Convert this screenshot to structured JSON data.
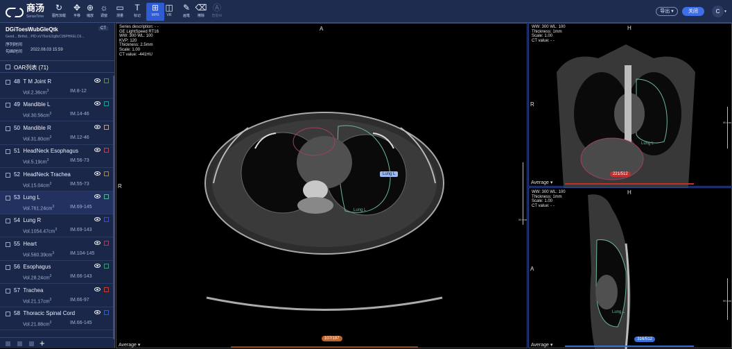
{
  "app": {
    "brand": "商汤",
    "brand_sub": "SenseTime"
  },
  "toolbar": {
    "tools": [
      {
        "id": "reset",
        "label": "图形加载",
        "icon": "reset-icon",
        "glyph": "↻"
      },
      {
        "id": "pan",
        "label": "平移",
        "icon": "pan-icon",
        "glyph": "✥"
      },
      {
        "id": "zoom",
        "label": "缩放",
        "icon": "zoom-icon",
        "glyph": "⊕"
      },
      {
        "id": "adjust",
        "label": "调窗",
        "icon": "brightness-icon",
        "glyph": "☼"
      },
      {
        "id": "measure",
        "label": "测量",
        "icon": "rectangle-icon",
        "glyph": "▭"
      },
      {
        "id": "annotate",
        "label": "标记",
        "icon": "text-icon",
        "glyph": "T"
      },
      {
        "id": "mpr",
        "label": "MPR",
        "icon": "mpr-layout-icon",
        "glyph": "⊞"
      },
      {
        "id": "vr",
        "label": "VR",
        "icon": "vr-layout-icon",
        "glyph": "◫"
      },
      {
        "id": "brush",
        "label": "画笔",
        "icon": "brush-icon",
        "glyph": "✎"
      },
      {
        "id": "erase",
        "label": "擦除",
        "icon": "eraser-icon",
        "glyph": "⌫"
      },
      {
        "id": "ai",
        "label": "智能AI",
        "icon": "ai-icon",
        "glyph": "Ⓐ"
      }
    ],
    "export_label": "导出",
    "close_label": "关闭",
    "avatar_letter": "C"
  },
  "patient": {
    "name": "DGiToesWubGleQtk",
    "modality": "CT",
    "meta": "Gend...   Birthd...   PID xV76xnU2g8cC95PHKELC6...",
    "seq_label": "序列时间",
    "draw_label": "勾画时间",
    "draw_time": "2022.08.03 15:59"
  },
  "oar": {
    "title": "OAR列表 (71)",
    "items": [
      {
        "idx": "48",
        "name": "T M Joint R",
        "vol": "Vol.2.36cm",
        "im": "IM.8-12",
        "color": "#5a8a5a"
      },
      {
        "idx": "49",
        "name": "Mandible L",
        "vol": "Vol.30.56cm",
        "im": "IM.14-46",
        "color": "#2a9aa0"
      },
      {
        "idx": "50",
        "name": "Mandible R",
        "vol": "Vol.31.80cm",
        "im": "IM.12-46",
        "color": "#b0a0a0"
      },
      {
        "idx": "51",
        "name": "HeadNeck Esophagus",
        "vol": "Vol.5.19cm",
        "im": "IM.56-73",
        "color": "#c04050"
      },
      {
        "idx": "52",
        "name": "HeadNeck Trachea",
        "vol": "Vol.15.04cm",
        "im": "IM.55-73",
        "color": "#a08850"
      },
      {
        "idx": "53",
        "name": "Lung L",
        "vol": "Vol.761.24cm",
        "im": "IM.69-145",
        "color": "#5ab0a0"
      },
      {
        "idx": "54",
        "name": "Lung R",
        "vol": "Vol.1054.47cm",
        "im": "IM.69-143",
        "color": "#4050c0"
      },
      {
        "idx": "55",
        "name": "Heart",
        "vol": "Vol.560.39cm",
        "im": "IM.104-145",
        "color": "#a04060"
      },
      {
        "idx": "56",
        "name": "Esophagus",
        "vol": "Vol.28.24cm",
        "im": "IM.66-143",
        "color": "#3a9a7a"
      },
      {
        "idx": "57",
        "name": "Trachea",
        "vol": "Vol.21.17cm",
        "im": "IM.66-97",
        "color": "#c04030"
      },
      {
        "idx": "58",
        "name": "Thoracic Spinal Cord",
        "vol": "Vol.21.88cm",
        "im": "IM.66-145",
        "color": "#3060c0"
      }
    ],
    "unit_sup": "3"
  },
  "axial": {
    "info": [
      "Series description: - -",
      "GE LightSpeed RT16",
      "WW: 300  WL: 100",
      "KVP: 120",
      "Thickness: 2.5mm",
      "Scale: 1.00",
      "CT value: -441HU"
    ],
    "orient_top": "A",
    "orient_left": "R",
    "contour_label": "Lung L",
    "contour_label2": "Lung L",
    "average_label": "Average",
    "slice": "107/197",
    "slice_frac": 0.54,
    "scale_label": "90 mm"
  },
  "coronal": {
    "info": [
      "WW: 300  WL: 100",
      "Thickness: 1mm",
      "Scale: 1.00",
      "CT value: - -"
    ],
    "orient_top": "H",
    "orient_left": "R",
    "contour_label": "Lung L",
    "average_label": "Average",
    "slice": "221/512",
    "slice_frac": 0.43,
    "scale_label": "90 mm"
  },
  "sagittal": {
    "info": [
      "WW: 300  WL: 100",
      "Thickness: 1mm",
      "Scale: 1.00",
      "CT value: - -"
    ],
    "orient_top": "H",
    "orient_left": "A",
    "contour_label": "Lung L",
    "average_label": "Average",
    "slice": "316/512",
    "slice_frac": 0.62,
    "scale_label": "90 mm"
  },
  "colors": {
    "accent": "#3f6fe8",
    "panel": "#1a2748",
    "topbar": "#1e2c4f",
    "slice_axial": "#c0632a",
    "slice_coronal": "#c03030",
    "slice_sagittal": "#3a6fd8"
  }
}
